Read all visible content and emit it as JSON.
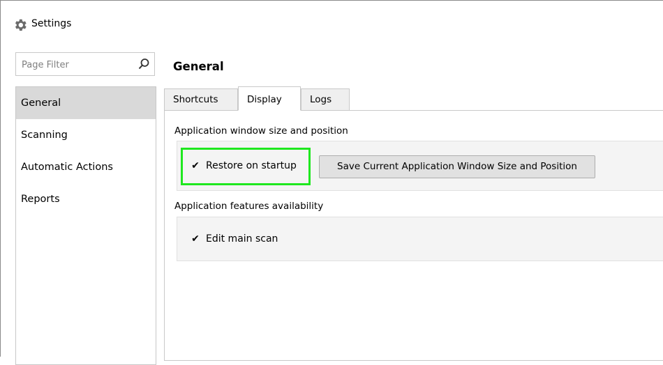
{
  "window": {
    "title": "Settings",
    "icon": "gear-icon"
  },
  "filter": {
    "placeholder": "Page Filter",
    "value": "",
    "icon": "search-icon"
  },
  "sidebar": {
    "items": [
      {
        "label": "General",
        "selected": true
      },
      {
        "label": "Scanning",
        "selected": false
      },
      {
        "label": "Automatic Actions",
        "selected": false
      },
      {
        "label": "Reports",
        "selected": false
      }
    ]
  },
  "page": {
    "title": "General"
  },
  "tabs": [
    {
      "label": "Shortcuts",
      "active": false
    },
    {
      "label": "Display",
      "active": true
    },
    {
      "label": "Logs",
      "active": false
    }
  ],
  "display": {
    "window_section": {
      "label": "Application window size and position",
      "restore_checkbox": {
        "label": "Restore on startup",
        "checked": true
      },
      "save_button": "Save Current Application Window Size and Position"
    },
    "features_section": {
      "label": "Application features availability",
      "edit_checkbox": {
        "label": "Edit main scan",
        "checked": true
      }
    }
  },
  "colors": {
    "highlight": "#1fe81f",
    "selected_bg": "#d9d9d9"
  },
  "check_glyph": "✔"
}
